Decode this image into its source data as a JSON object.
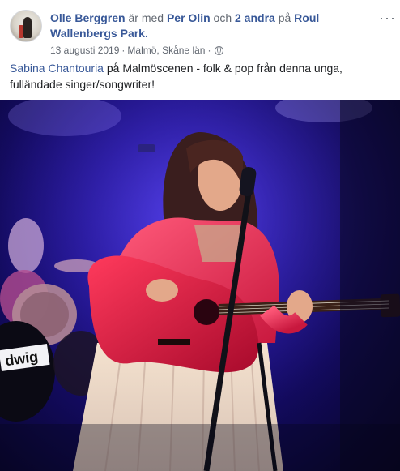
{
  "post": {
    "author": "Olle Berggren",
    "with_text": "är med",
    "tagged_person": "Per Olin",
    "and_text": "och",
    "others_link": "2 andra",
    "at_text": "på",
    "place": "Roul Wallenbergs Park",
    "period": ".",
    "date": "13 augusti 2019",
    "separator": "·",
    "location": "Malmö, Skåne län",
    "separator2": "·",
    "privacy_icon": "globe-icon",
    "more_icon": "more-options-icon",
    "more_glyph": "···"
  },
  "message": {
    "mention": "Sabina Chantouria",
    "text": "på Malmöscenen - folk & pop från denna unga, fulländade singer/songwriter!"
  },
  "video": {
    "content": "singer-with-red-guitar-on-stage",
    "drum_brand_text": "dwig"
  }
}
